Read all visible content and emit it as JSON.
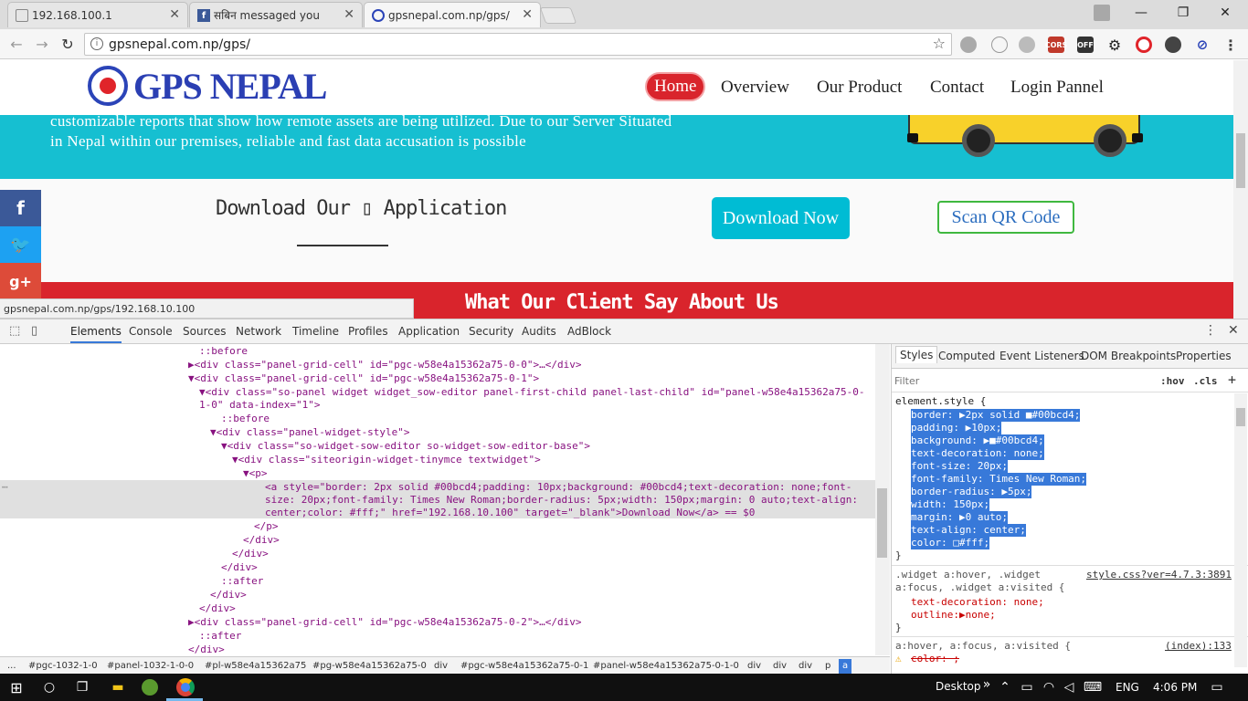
{
  "browser": {
    "tabs": [
      {
        "title": "192.168.100.1",
        "active": false
      },
      {
        "title": "सबिन messaged you",
        "active": false
      },
      {
        "title": "gpsnepal.com.np/gps/",
        "active": true
      }
    ],
    "url": "gpsnepal.com.np/gps/",
    "status_url": "gpsnepal.com.np/gps/192.168.10.100",
    "extensions": [
      "cloud-icon",
      "circle-icon",
      "cloud-upload-icon",
      "CORS",
      "OFF",
      "gear-icon",
      "opera-icon",
      "incognito-icon",
      "block-icon"
    ]
  },
  "site": {
    "logo_text": "GPS NEPAL",
    "nav": [
      "Home",
      "Overview",
      "Our Product",
      "Contact",
      "Login Pannel"
    ],
    "hero_lines": [
      "customizable reports that show how remote assets are being utilized. Due to our Server Situated",
      "in Nepal within our premises, reliable and fast data accusation is possible"
    ],
    "download_title": "Download Our ▯ Application",
    "download_button": "Download Now",
    "qr_button": "Scan QR Code",
    "client_title": "What Our Client Say About Us",
    "social": [
      "f",
      "🐦",
      "g+"
    ]
  },
  "devtools": {
    "tabs": [
      "Elements",
      "Console",
      "Sources",
      "Network",
      "Timeline",
      "Profiles",
      "Application",
      "Security",
      "Audits",
      "AdBlock"
    ],
    "elements_lines": [
      "::before",
      "▶<div class=\"panel-grid-cell\" id=\"pgc-w58e4a15362a75-0-0\">…</div>",
      "▼<div class=\"panel-grid-cell\" id=\"pgc-w58e4a15362a75-0-1\">",
      "▼<div class=\"so-panel widget widget_sow-editor panel-first-child panel-last-child\" id=\"panel-w58e4a15362a75-0-",
      "1-0\" data-index=\"1\">",
      "::before",
      "▼<div class=\"panel-widget-style\">",
      "▼<div class=\"so-widget-sow-editor so-widget-sow-editor-base\">",
      "▼<div class=\"siteorigin-widget-tinymce textwidget\">",
      "▼<p>",
      "<a style=\"border: 2px solid #00bcd4;padding: 10px;background: #00bcd4;text-decoration: none;font-",
      "size: 20px;font-family: Times New Roman;border-radius: 5px;width: 150px;margin: 0 auto;text-align:",
      "center;color: #fff;\" href=\"192.168.10.100\" target=\"_blank\">Download Now</a> == $0",
      "</p>",
      "</div>",
      "</div>",
      "</div>",
      "::after",
      "</div>",
      "</div>",
      "▶<div class=\"panel-grid-cell\" id=\"pgc-w58e4a15362a75-0-2\">…</div>",
      "::after",
      "</div>"
    ],
    "breadcrumbs": [
      "...",
      "#pgc-1032-1-0",
      "#panel-1032-1-0-0",
      "#pl-w58e4a15362a75",
      "#pg-w58e4a15362a75-0",
      "div",
      "#pgc-w58e4a15362a75-0-1",
      "#panel-w58e4a15362a75-0-1-0",
      "div",
      "div",
      "div",
      "p",
      "a"
    ],
    "style_tabs": [
      "Styles",
      "Computed",
      "Event Listeners",
      "DOM Breakpoints",
      "Properties"
    ],
    "filter_placeholder": "Filter",
    "filter_hov": ":hov",
    "filter_cls": ".cls",
    "element_style": {
      "selector": "element.style {",
      "props": [
        "border: ▶2px solid ■#00bcd4;",
        "padding: ▶10px;",
        "background: ▶■#00bcd4;",
        "text-decoration: none;",
        "font-size: 20px;",
        "font-family: Times New Roman;",
        "border-radius: ▶5px;",
        "width: 150px;",
        "margin: ▶0 auto;",
        "text-align: center;",
        "color: □#fff;"
      ],
      "close": "}"
    },
    "rule2": {
      "selector": ".widget a:hover, .widget",
      "selector2": "a:focus, .widget a:visited {",
      "source": "style.css?ver=4.7.3:3891",
      "props": [
        "text-decoration: none;",
        "outline:▶none;"
      ],
      "close": "}"
    },
    "rule3": {
      "selector": "a:hover, a:focus, a:visited {",
      "source": "(index):133",
      "props": [
        "color: ;"
      ]
    }
  },
  "taskbar": {
    "desktop": "Desktop",
    "lang": "ENG",
    "time": "4:06 PM"
  }
}
